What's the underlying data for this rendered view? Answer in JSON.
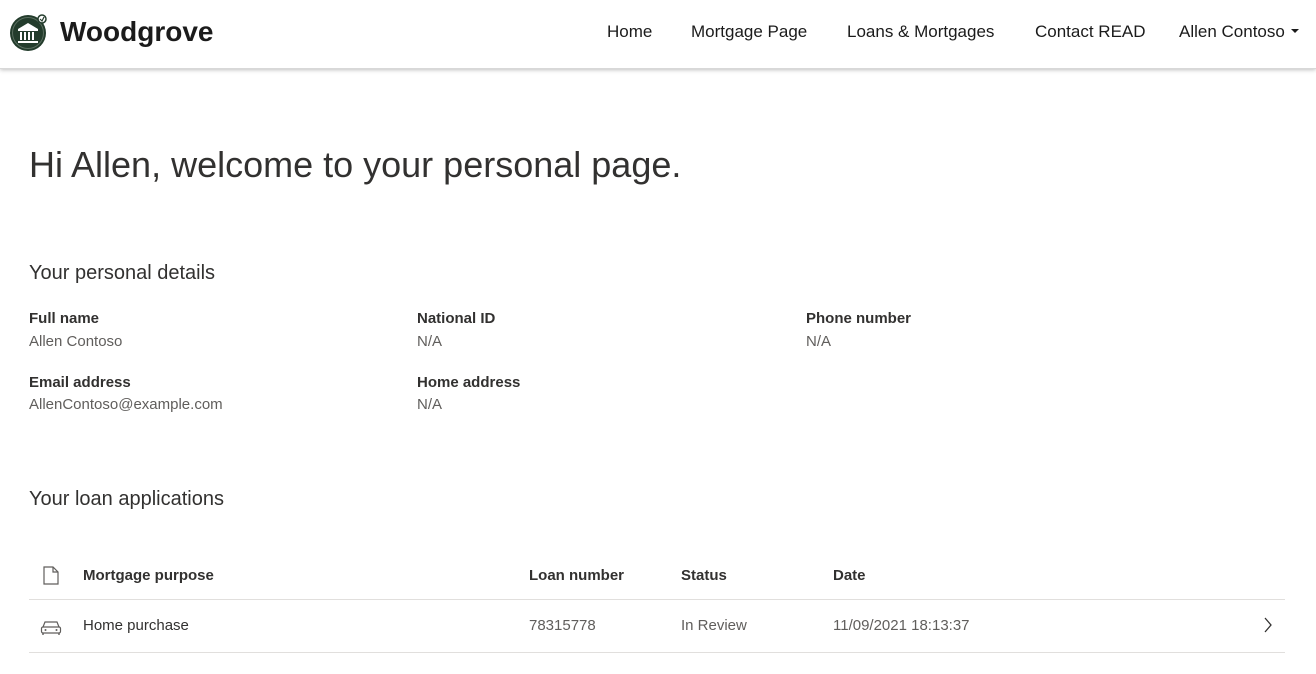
{
  "header": {
    "brand": "Woodgrove",
    "nav": [
      {
        "label": "Home"
      },
      {
        "label": "Mortgage Page"
      },
      {
        "label": "Loans & Mortgages"
      },
      {
        "label": "Contact READ"
      }
    ],
    "user_menu": "Allen Contoso",
    "accent": "#233c2c"
  },
  "welcome": "Hi Allen, welcome to your personal page.",
  "personal": {
    "title": "Your personal details",
    "fields": [
      {
        "label": "Full name",
        "value": "Allen Contoso"
      },
      {
        "label": "National ID",
        "value": "N/A"
      },
      {
        "label": "Phone number",
        "value": "N/A"
      },
      {
        "label": "Email address",
        "value": "AllenContoso@example.com"
      },
      {
        "label": "Home address",
        "value": "N/A"
      }
    ]
  },
  "loans": {
    "title": "Your loan applications",
    "columns": [
      "Mortgage purpose",
      "Loan number",
      "Status",
      "Date"
    ],
    "header_icon": "document-icon",
    "rows": [
      {
        "icon": "car-icon",
        "purpose": "Home purchase",
        "loan_number": "78315778",
        "status": "In Review",
        "date": "11/09/2021 18:13:37"
      }
    ]
  }
}
